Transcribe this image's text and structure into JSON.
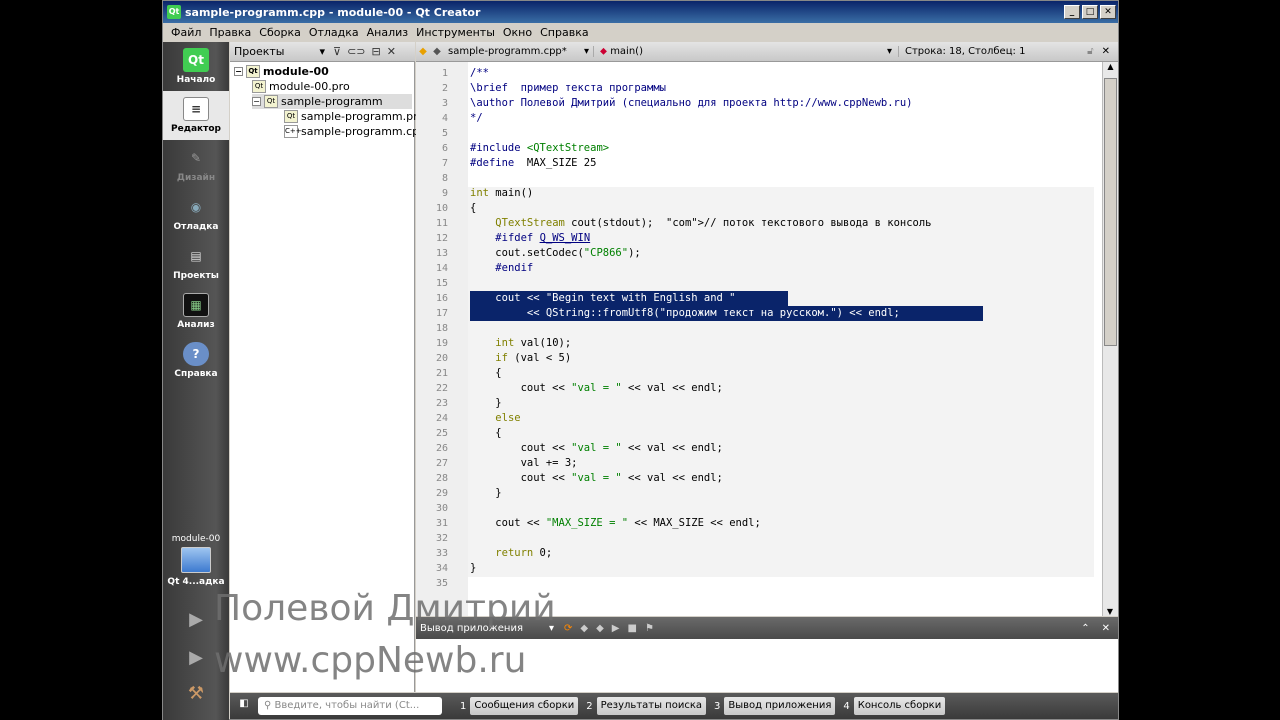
{
  "window": {
    "title": "sample-programm.cpp - module-00 - Qt Creator",
    "app_icon": "Qt"
  },
  "menu": [
    "Файл",
    "Правка",
    "Сборка",
    "Отладка",
    "Анализ",
    "Инструменты",
    "Окно",
    "Справка"
  ],
  "modes": [
    {
      "label": "Начало",
      "icon": "qt-logo-icon",
      "glyph": "Qt"
    },
    {
      "label": "Редактор",
      "icon": "editor-icon",
      "glyph": "≡"
    },
    {
      "label": "Дизайн",
      "icon": "design-icon",
      "glyph": "✎"
    },
    {
      "label": "Отладка",
      "icon": "debug-icon",
      "glyph": "◉"
    },
    {
      "label": "Проекты",
      "icon": "projects-icon",
      "glyph": "▤"
    },
    {
      "label": "Анализ",
      "icon": "analyze-icon",
      "glyph": "▦"
    },
    {
      "label": "Справка",
      "icon": "help-icon",
      "glyph": "?"
    }
  ],
  "target": {
    "project": "module-00",
    "kit": "Qt 4...адка"
  },
  "projects_panel": {
    "title": "Проекты",
    "tree": [
      {
        "label": "module-00",
        "level": 0
      },
      {
        "label": "module-00.pro",
        "level": 1
      },
      {
        "label": "sample-programm",
        "level": 1
      },
      {
        "label": "sample-programm.pro",
        "level": 2
      },
      {
        "label": "sample-programm.cpp",
        "level": 2
      }
    ]
  },
  "editor": {
    "file": "sample-programm.cpp*",
    "function": "main()",
    "position": "Строка: 18, Столбец: 1",
    "lines": [
      "/**",
      "\\brief  пример текста программы",
      "\\author Полевой Дмитрий (специально для проекта http://www.cppNewb.ru)",
      "*/",
      "",
      "#include <QTextStream>",
      "#define  MAX_SIZE 25",
      "",
      "int main()",
      "{",
      "    QTextStream cout(stdout);  // поток текстового вывода в консоль",
      "    #ifdef Q_WS_WIN",
      "    cout.setCodec(\"CP866\");",
      "    #endif",
      "",
      "    cout << \"Begin text with English and \"",
      "         << QString::fromUtf8(\"продожим текст на русском.\") << endl;",
      "",
      "    int val(10);",
      "    if (val < 5)",
      "    {",
      "        cout << \"val = \" << val << endl;",
      "    }",
      "    else",
      "    {",
      "        cout << \"val = \" << val << endl;",
      "        val += 3;",
      "        cout << \"val = \" << val << endl;",
      "    }",
      "",
      "    cout << \"MAX_SIZE = \" << MAX_SIZE << endl;",
      "",
      "    return 0;",
      "}",
      ""
    ]
  },
  "output": {
    "title": "Вывод приложения"
  },
  "statusbar": {
    "search_placeholder": "Введите, чтобы найти (Ct...",
    "buttons": [
      {
        "num": "1",
        "label": "Сообщения сборки"
      },
      {
        "num": "2",
        "label": "Результаты поиска"
      },
      {
        "num": "3",
        "label": "Вывод приложения"
      },
      {
        "num": "4",
        "label": "Консоль сборки"
      }
    ]
  },
  "watermark": [
    "Полевой Дмитрий",
    "www.cppNewb.ru"
  ]
}
